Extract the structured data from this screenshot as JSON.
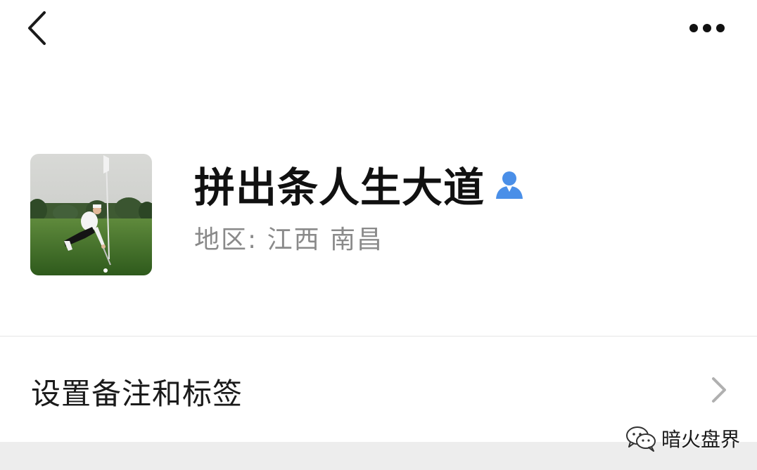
{
  "topbar": {
    "back_icon": "chevron-left-icon",
    "more_icon": "more-dots-icon"
  },
  "profile": {
    "avatar_description_icon": "avatar-photo",
    "nickname": "拼出条人生大道",
    "gender_icon": "male-user-icon",
    "gender_color": "#4a8fe8",
    "region_text": "地区:  江西   南昌"
  },
  "remark_row": {
    "label": "设置备注和标签",
    "chevron_icon": "chevron-right-icon"
  },
  "watermark": {
    "icon": "wechat-icon",
    "text": "暗火盘界"
  }
}
